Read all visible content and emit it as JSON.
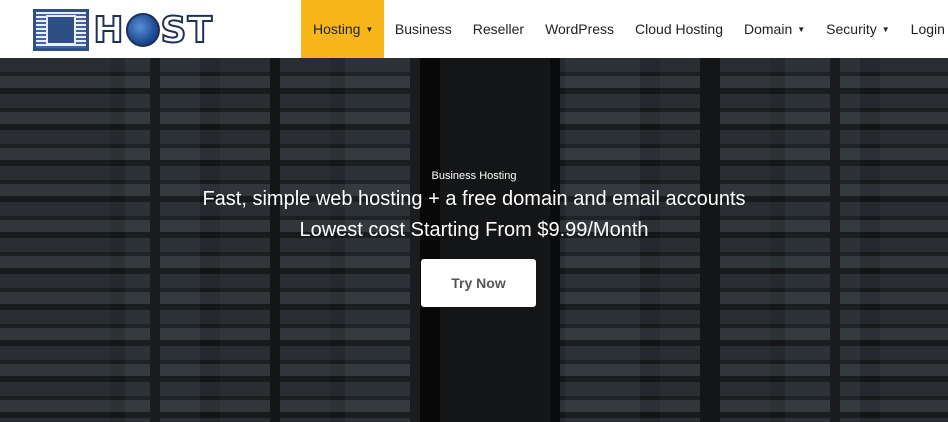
{
  "brand": {
    "logo_text": "HOST"
  },
  "nav": {
    "items": [
      {
        "label": "Hosting",
        "has_dropdown": true,
        "active": true
      },
      {
        "label": "Business",
        "has_dropdown": false
      },
      {
        "label": "Reseller",
        "has_dropdown": false
      },
      {
        "label": "WordPress",
        "has_dropdown": false
      },
      {
        "label": "Cloud Hosting",
        "has_dropdown": false
      },
      {
        "label": "Domain",
        "has_dropdown": true
      },
      {
        "label": "Security",
        "has_dropdown": true
      },
      {
        "label": "Login",
        "has_dropdown": false
      }
    ],
    "dropdown_icon": "caret-down-icon"
  },
  "hero": {
    "eyebrow": "Business Hosting",
    "headline": "Fast, simple web hosting + a free domain and email accounts",
    "subline": "Lowest cost Starting From $9.99/Month",
    "cta_label": "Try Now"
  },
  "colors": {
    "active_nav": "#f7b71b",
    "brand_blue": "#2e4f86"
  }
}
